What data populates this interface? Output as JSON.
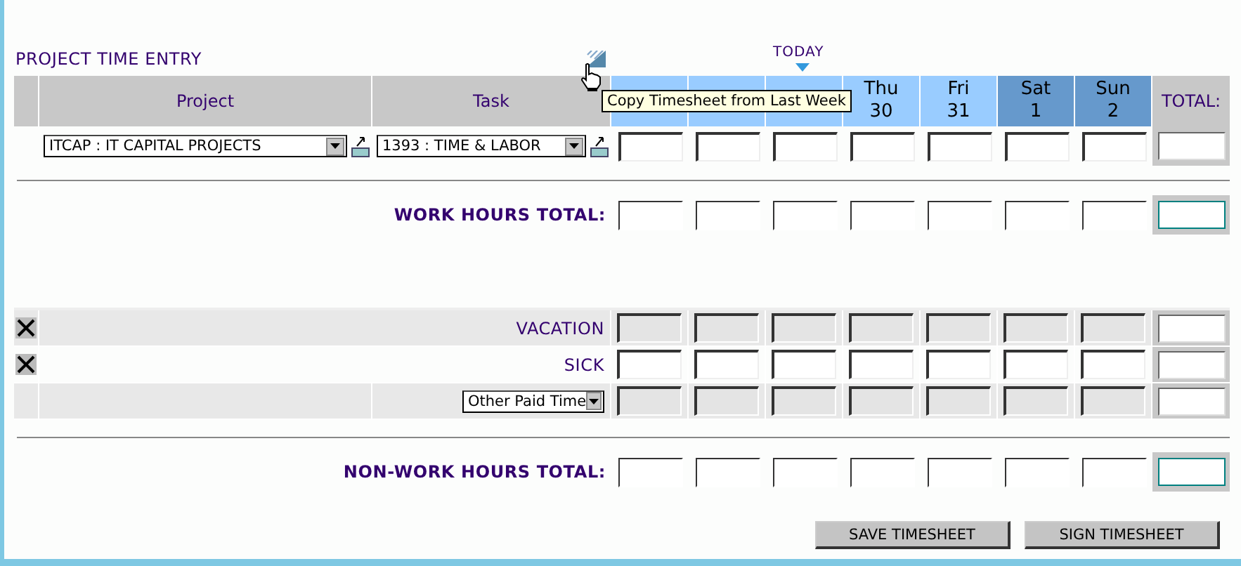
{
  "title": "PROJECT TIME ENTRY",
  "today_label": "TODAY",
  "columns": {
    "project": "Project",
    "task": "Task",
    "total": "TOTAL:"
  },
  "days": [
    {
      "today": false,
      "weekend": false
    },
    {
      "today": false,
      "weekend": false
    },
    {
      "today": true,
      "weekend": false
    },
    {
      "name": "Thu",
      "date": "30",
      "today": false,
      "weekend": false
    },
    {
      "name": "Fri",
      "date": "31",
      "today": false,
      "weekend": false
    },
    {
      "name": "Sat",
      "date": "1",
      "today": false,
      "weekend": true
    },
    {
      "name": "Sun",
      "date": "2",
      "today": false,
      "weekend": true
    }
  ],
  "tooltip": "Copy Timesheet from Last Week",
  "entry": {
    "project": "ITCAP : IT CAPITAL PROJECTS",
    "task": "1393 : TIME & LABOR"
  },
  "work_total_label": "WORK HOURS TOTAL:",
  "non_work_rows": [
    {
      "kind": "fixed",
      "label": "VACATION",
      "shaded": true
    },
    {
      "kind": "fixed",
      "label": "SICK",
      "shaded": false
    },
    {
      "kind": "select",
      "value": "Other Paid Time",
      "shaded": true
    }
  ],
  "non_work_total_label": "NON-WORK HOURS TOTAL:",
  "buttons": [
    "SAVE TIMESHEET",
    "SIGN TIMESHEET"
  ]
}
